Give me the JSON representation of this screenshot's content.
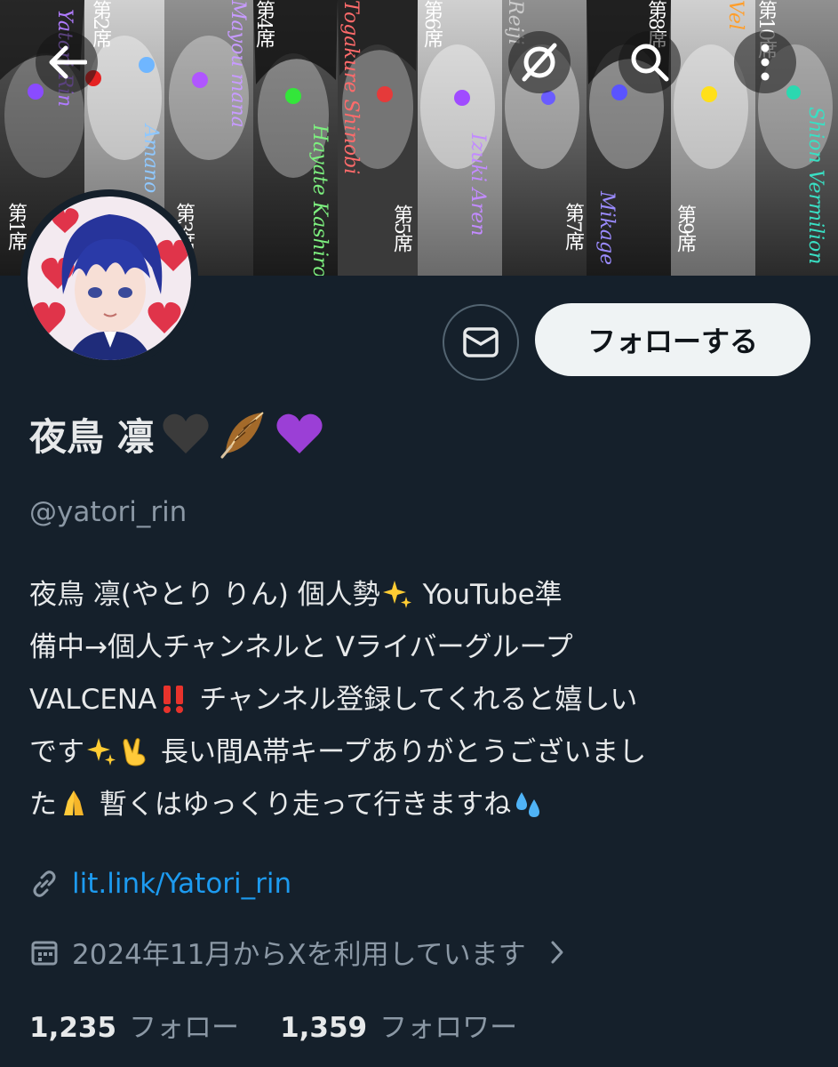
{
  "banner": {
    "panels": [
      {
        "seat": "第1席",
        "name": "Yatori Rin"
      },
      {
        "seat": "第2席",
        "name": "Amano"
      },
      {
        "seat": "第3席",
        "name": "Mayou mana"
      },
      {
        "seat": "第4席",
        "name": "Hayate Kashiro"
      },
      {
        "seat": "第5席",
        "name": "Togakure Shinobi"
      },
      {
        "seat": "第6席",
        "name": "Izuki Aren"
      },
      {
        "seat": "第7席",
        "name": "Mikage"
      },
      {
        "seat": "第8席",
        "name": "Reiji"
      },
      {
        "seat": "第9席",
        "name": "Vel"
      },
      {
        "seat": "第10席",
        "name": "Shion Vermilion"
      }
    ],
    "icons": {
      "back": "arrow-left-icon",
      "grok": "grok-icon",
      "search": "search-icon",
      "more": "more-vertical-icon"
    }
  },
  "actions": {
    "dm_icon": "envelope-icon",
    "follow_label": "フォローする"
  },
  "profile": {
    "display_name": "夜鳥 凛",
    "name_emojis": [
      "black-heart-emoji",
      "feather-emoji",
      "purple-heart-emoji"
    ],
    "handle": "@yatori_rin",
    "bio_lines": [
      "夜鳥 凛(やとり りん) 個人勢",
      "YouTube準",
      "備中→個人チャンネルと Vライバーグループ",
      "VALCENA",
      "チャンネル登録してくれると嬉しい",
      "です",
      "長い間A帯キープありがとうございまし",
      "た",
      "暫くはゆっくり走って行きますね"
    ],
    "link": "lit.link/Yatori_rin",
    "joined": "2024年11月からXを利用しています"
  },
  "stats": {
    "following_count": "1,235",
    "following_label": "フォロー",
    "followers_count": "1,359",
    "followers_label": "フォロワー"
  },
  "colors": {
    "background": "#15202b",
    "text": "#e7e9ea",
    "muted": "#8b98a5",
    "link": "#1d9bf0",
    "follow_bg": "#eff3f4"
  }
}
